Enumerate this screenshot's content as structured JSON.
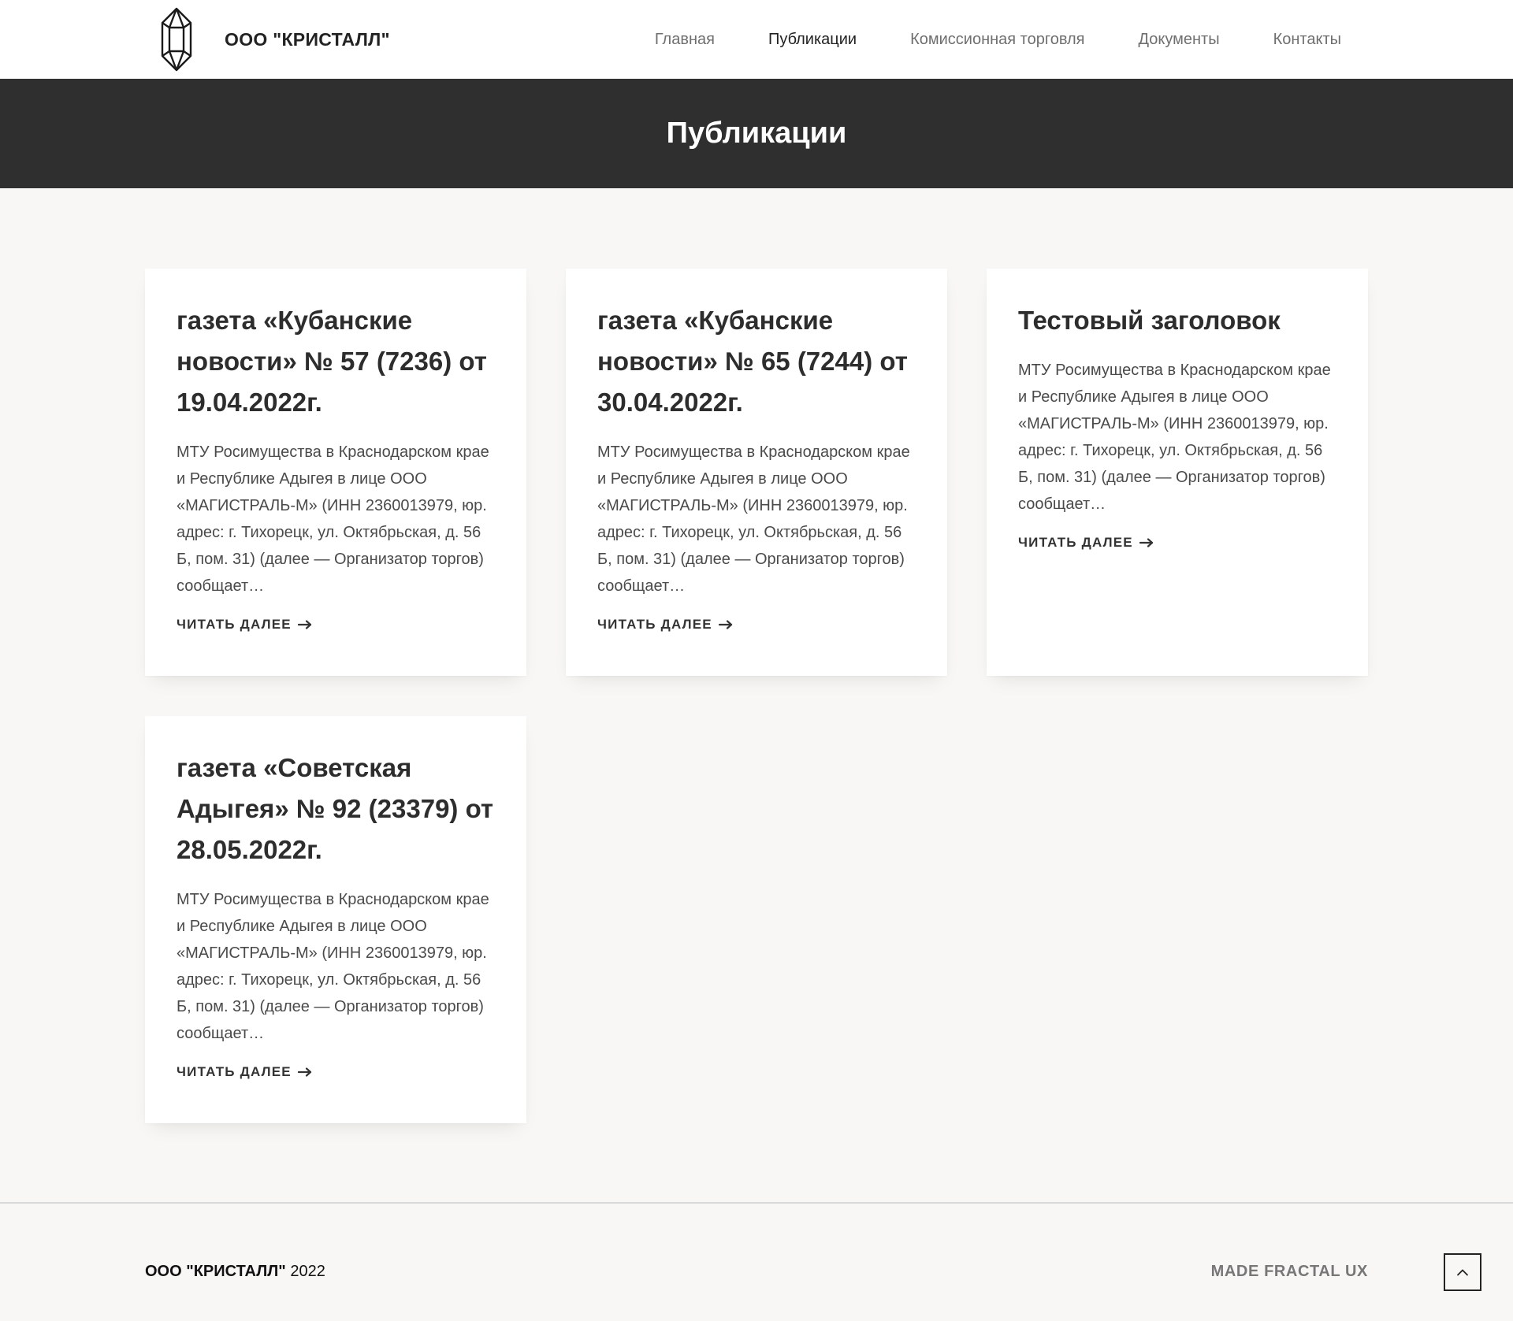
{
  "header": {
    "brand_name": "ООО \"КРИСТАЛЛ\"",
    "logo_icon": "crystal-icon",
    "nav": [
      {
        "label": "Главная",
        "active": false
      },
      {
        "label": "Публикации",
        "active": true
      },
      {
        "label": "Комиссионная торговля",
        "active": false
      },
      {
        "label": "Документы",
        "active": false
      },
      {
        "label": "Контакты",
        "active": false
      }
    ]
  },
  "page": {
    "title": "Публикации"
  },
  "posts": [
    {
      "title": "газета «Кубанские новости» № 57 (7236) от 19.04.2022г.",
      "excerpt": "МТУ Росимущества в Краснодарском крае и Республике Адыгея в лице ООО «МАГИСТРАЛЬ-М» (ИНН 2360013979, юр. адрес: г. Тихорецк, ул. Октябрьская, д. 56 Б, пом. 31) (далее — Организатор торгов) сообщает…",
      "read_more": "ЧИТАТЬ ДАЛЕЕ"
    },
    {
      "title": "газета «Кубанские новости» № 65 (7244) от 30.04.2022г.",
      "excerpt": "МТУ Росимущества в Краснодарском крае и Республике Адыгея в лице ООО «МАГИСТРАЛЬ-М» (ИНН 2360013979, юр. адрес: г. Тихорецк, ул. Октябрьская, д. 56 Б, пом. 31) (далее — Организатор торгов) сообщает…",
      "read_more": "ЧИТАТЬ ДАЛЕЕ"
    },
    {
      "title": "Тестовый заголовок",
      "excerpt": "МТУ Росимущества в Краснодарском крае и Республике Адыгея в лице ООО «МАГИСТРАЛЬ-М» (ИНН 2360013979, юр. адрес: г. Тихорецк, ул. Октябрьская, д. 56 Б, пом. 31) (далее — Организатор торгов) сообщает…",
      "read_more": "ЧИТАТЬ ДАЛЕЕ"
    },
    {
      "title": "газета «Советская Адыгея» № 92 (23379) от 28.05.2022г.",
      "excerpt": "МТУ Росимущества в Краснодарском крае и Республике Адыгея в лице ООО «МАГИСТРАЛЬ-М» (ИНН 2360013979, юр. адрес: г. Тихорецк, ул. Октябрьская, д. 56 Б, пом. 31) (далее — Организатор торгов) сообщает…",
      "read_more": "ЧИТАТЬ ДАЛЕЕ"
    }
  ],
  "footer": {
    "brand": "ООО \"КРИСТАЛЛ\"",
    "year": "2022",
    "made_by": "MADE FRACTAL UX",
    "scroll_top_icon": "chevron-up-icon"
  },
  "colors": {
    "page_background": "#f8f7f5",
    "title_band": "#2f2f2f",
    "text": "#2d2d2d",
    "nav_inactive": "#6f6f6f"
  }
}
